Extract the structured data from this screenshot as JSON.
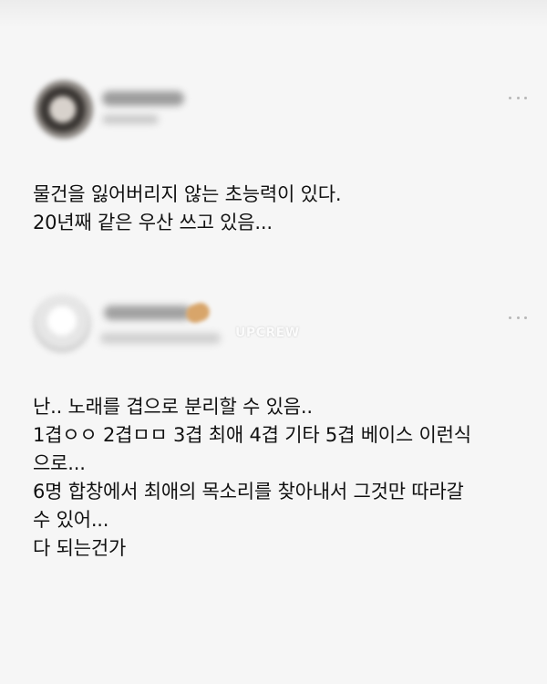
{
  "watermark": "UPCREW",
  "posts": [
    {
      "text_lines": [
        "물건을 잃어버리지 않는 초능력이 있다.",
        "20년째 같은 우산 쓰고 있음..."
      ]
    },
    {
      "text_lines": [
        "난..  노래를 겹으로 분리할 수 있음..",
        "1겹ㅇㅇ 2겹ㅁㅁ 3겹 최애 4겹 기타 5겹 베이스 이런식",
        "으로...",
        "6명 합창에서 최애의 목소리를 찾아내서 그것만 따라갈",
        "수 있어...",
        "다 되는건가"
      ]
    }
  ]
}
